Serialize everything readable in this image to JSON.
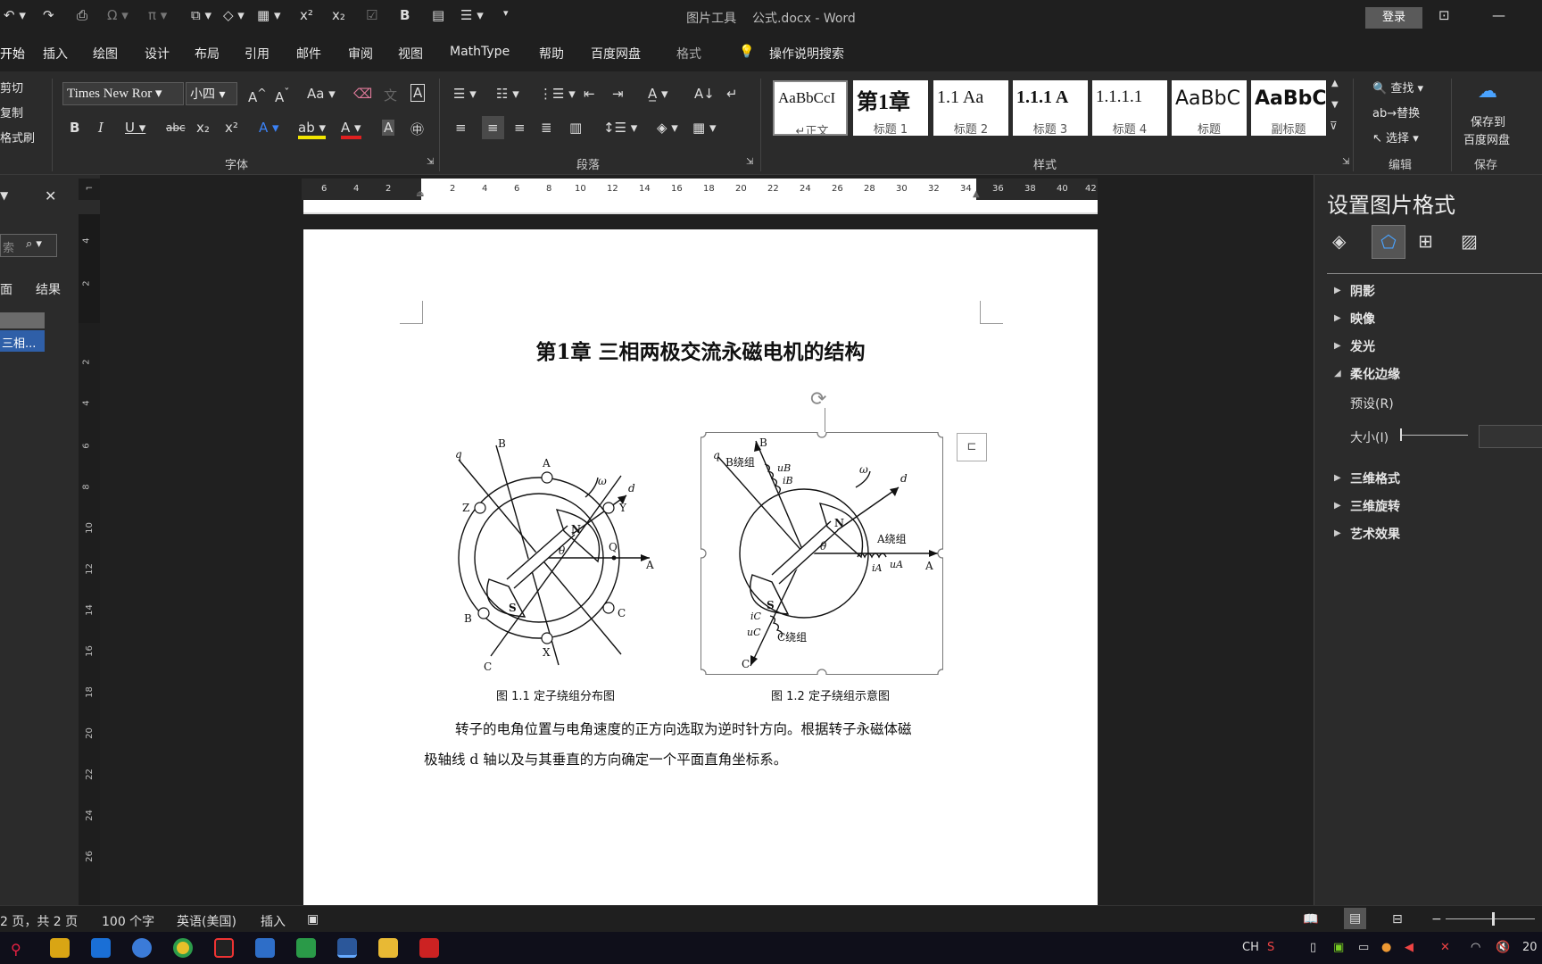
{
  "window": {
    "context_tab": "图片工具",
    "document_title": "公式.docx - Word",
    "login": "登录"
  },
  "tabs": [
    "开始",
    "插入",
    "绘图",
    "设计",
    "布局",
    "引用",
    "邮件",
    "审阅",
    "视图",
    "MathType",
    "帮助",
    "百度网盘",
    "格式"
  ],
  "tell_me": "操作说明搜索",
  "clipboard": {
    "cut": "剪切",
    "copy": "复制",
    "format_painter": "格式刷"
  },
  "font": {
    "name": "Times New Roman",
    "name_display": "Times New Ror",
    "size": "小四",
    "group_label": "字体",
    "case_btn": "Aa"
  },
  "paragraph": {
    "group_label": "段落"
  },
  "styles": {
    "group_label": "样式",
    "items": [
      {
        "sample": "AaBbCcI",
        "name": "↵正文"
      },
      {
        "sample": "第1章",
        "name": "标题 1"
      },
      {
        "sample": "1.1  Aa",
        "name": "标题 2"
      },
      {
        "sample": "1.1.1  A",
        "name": "标题 3"
      },
      {
        "sample": "1.1.1.1",
        "name": "标题 4"
      },
      {
        "sample": "AaBbC",
        "name": "标题"
      },
      {
        "sample": "AaBbC",
        "name": "副标题"
      }
    ]
  },
  "editing": {
    "find": "查找",
    "replace": "替换",
    "select": "选择",
    "group_label": "编辑"
  },
  "save_group": {
    "save_to": "保存到",
    "baidu": "百度网盘",
    "group_label": "保存"
  },
  "nav_pane": {
    "search_placeholder": "索",
    "tab_pages": "面",
    "tab_results": "结果",
    "result_item": "三相..."
  },
  "document": {
    "chapter_title": "第1章  三相两极交流永磁电机的结构",
    "fig1_caption": "图  1.1  定子绕组分布图",
    "fig2_caption": "图  1.2  定子绕组示意图",
    "paragraph_line1": "转子的电角位置与电角速度的正方向选取为逆时针方向。根据转子永磁体磁",
    "paragraph_line2": "极轴线 d 轴以及与其垂直的方向确定一个平面直角坐标系。",
    "fig1_labels": {
      "q": "q",
      "B": "B",
      "A": "A",
      "d": "d",
      "omega": "ω",
      "Z": "Z",
      "Y": "Y",
      "N": "N",
      "theta": "θ",
      "Q": "Q",
      "A2": "A",
      "S": "S",
      "B2": "B",
      "C2": "C",
      "X": "X",
      "C": "C"
    },
    "fig2_labels": {
      "q": "q",
      "B": "B",
      "Bwinding": "B绕组",
      "uB": "uB",
      "iB": "iB",
      "omega": "ω",
      "d": "d",
      "N": "N",
      "theta": "θ",
      "Awinding": "A绕组",
      "iA": "iA",
      "uA": "uA",
      "A": "A",
      "S": "S",
      "iC": "iC",
      "uC": "uC",
      "Cwinding": "C绕组",
      "C": "C"
    }
  },
  "ruler_h": [
    "6",
    "4",
    "2",
    "2",
    "4",
    "6",
    "8",
    "10",
    "12",
    "14",
    "16",
    "18",
    "20",
    "22",
    "24",
    "26",
    "28",
    "30",
    "32",
    "34",
    "36",
    "38",
    "40",
    "42"
  ],
  "ruler_v": [
    "4",
    "2",
    "2",
    "4",
    "6",
    "8",
    "10",
    "12",
    "14",
    "16",
    "18",
    "20",
    "22",
    "24",
    "26"
  ],
  "format_pane": {
    "title": "设置图片格式",
    "items": [
      "阴影",
      "映像",
      "发光",
      "柔化边缘",
      "三维格式",
      "三维旋转",
      "艺术效果"
    ],
    "preset": "预设(R)",
    "size": "大小(I)"
  },
  "status": {
    "pages": "2 页，共 2 页",
    "words": "100 个字",
    "language": "英语(美国)",
    "mode": "插入"
  },
  "taskbar": {
    "ime": "CH",
    "clock": "20"
  }
}
